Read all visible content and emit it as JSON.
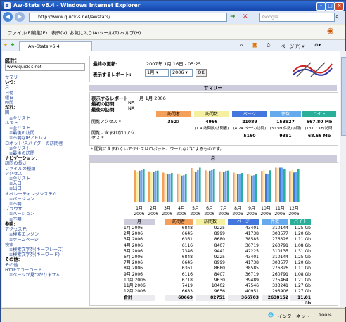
{
  "window": {
    "title": "Aw-Stats v6.4 - Windows Internet Explorer"
  },
  "address": {
    "url": "http://www.quick-s.net/awstats/",
    "search_placeholder": "Google"
  },
  "menu": [
    "ファイル(F)",
    "編集(E)",
    "表示(V)",
    "お気に入り(A)",
    "ツール(T)",
    "ヘルプ(H)"
  ],
  "tab": {
    "label": "Aw-Stats v6.4"
  },
  "toolbar": {
    "page_label": "ページ(P) ▾"
  },
  "status": {
    "zone": "インターネット",
    "zoom": "100%"
  },
  "sidebar": {
    "stats_label": "統計：",
    "site": "www.quick-s.net",
    "items": [
      {
        "text": "サマリー",
        "cls": "",
        "link": true
      },
      {
        "text": "いつ：",
        "cls": "h"
      },
      {
        "text": "月",
        "cls": "",
        "link": true
      },
      {
        "text": "日付",
        "cls": "",
        "link": true
      },
      {
        "text": "曜日",
        "cls": "",
        "link": true
      },
      {
        "text": "時間",
        "cls": "",
        "link": true
      },
      {
        "text": "だれ：",
        "cls": "h"
      },
      {
        "text": "国",
        "cls": "",
        "link": true
      },
      {
        "text": "≡全リスト",
        "cls": "s1",
        "link": true
      },
      {
        "text": "ホスト",
        "cls": "",
        "link": true
      },
      {
        "text": "≡全リスト",
        "cls": "s1",
        "link": true
      },
      {
        "text": "≡最後の訪問",
        "cls": "s1",
        "link": true
      },
      {
        "text": "≡不明なIPアドレス",
        "cls": "s1",
        "link": true
      },
      {
        "text": "ロボット/スパイダーの訪問者",
        "cls": "",
        "link": true
      },
      {
        "text": "≡全リスト",
        "cls": "s1",
        "link": true
      },
      {
        "text": "≡最後の訪問",
        "cls": "s1",
        "link": true
      },
      {
        "text": "ナビゲーション：",
        "cls": "h"
      },
      {
        "text": "訪問の長さ",
        "cls": "",
        "link": true
      },
      {
        "text": "ファイルの種類",
        "cls": "",
        "link": true
      },
      {
        "text": "アクセス",
        "cls": "",
        "link": true
      },
      {
        "text": "≡全リスト",
        "cls": "s1",
        "link": true
      },
      {
        "text": "≡入口",
        "cls": "s1",
        "link": true
      },
      {
        "text": "≡出口",
        "cls": "s1",
        "link": true
      },
      {
        "text": "オペレーティングシステム",
        "cls": "",
        "link": true
      },
      {
        "text": "≡バージョン",
        "cls": "s1",
        "link": true
      },
      {
        "text": "≡不明",
        "cls": "s1",
        "link": true
      },
      {
        "text": "ブラウザ",
        "cls": "",
        "link": true
      },
      {
        "text": "≡バージョン",
        "cls": "s1",
        "link": true
      },
      {
        "text": "≡不明",
        "cls": "s1",
        "link": true
      },
      {
        "text": "参照：",
        "cls": "h"
      },
      {
        "text": "アクセス元",
        "cls": "",
        "link": true
      },
      {
        "text": "≡検索エンジン",
        "cls": "s1",
        "link": true
      },
      {
        "text": "≡ホームページ",
        "cls": "s1",
        "link": true
      },
      {
        "text": "検索",
        "cls": "",
        "link": true
      },
      {
        "text": "≡検索文字列(キーフレーズ)",
        "cls": "s1",
        "link": true
      },
      {
        "text": "≡検索文字列(キーワード)",
        "cls": "s1",
        "link": true
      },
      {
        "text": "その他：",
        "cls": "h"
      },
      {
        "text": "その他",
        "cls": "",
        "link": true
      },
      {
        "text": "HTTPエラーコード",
        "cls": "",
        "link": true
      },
      {
        "text": "≡ページが見つかりません",
        "cls": "s1",
        "link": true
      }
    ]
  },
  "header": {
    "last_update_label": "最終の更新:",
    "last_update": "2007年 1月 16日 - 05:25",
    "report_label": "表示するレポート:",
    "month": "1月",
    "year": "2006",
    "ok": "OK"
  },
  "summary": {
    "title": "サマリー",
    "report_label": "表示するレポート",
    "report_value": "月 1月 2006",
    "first_visit_label": "最初の訪問",
    "first_visit": "NA",
    "last_visit_label": "最後の訪問",
    "last_visit": "NA",
    "cols": [
      "訪問者",
      "訪問数",
      "ページ",
      "件数",
      "バイト"
    ],
    "col_colors": [
      "#f4a05a",
      "#f4f0a0",
      "#4477dd",
      "#66aaee",
      "#2ab09a"
    ],
    "row1_label": "閲覧アクセス *",
    "row1": [
      "3527",
      "4966",
      "21089",
      "153927",
      "667.80 Mb"
    ],
    "row1_sub": [
      "",
      "(1.4 訪問数/訪問者)",
      "(4.24 ページ/訪問)",
      "(30.99 件数/訪問)",
      "(137.7 Kb/訪問)"
    ],
    "row2_label": "閲覧に含まれないアクセス *",
    "row2": [
      "",
      "",
      "5160",
      "9391",
      "68.66 Mb"
    ],
    "note": "* 閲覧に含まれないアクセスはロボット、ワームなどによるものです。"
  },
  "monthly": {
    "title": "月",
    "cols": [
      "月",
      "訪問者",
      "訪問数",
      "ページ",
      "件数",
      "バイト"
    ],
    "rows": [
      [
        "1月 2006",
        "6848",
        "9225",
        "43401",
        "310144",
        "1.25 Gb"
      ],
      [
        "2月 2006",
        "6645",
        "8999",
        "41738",
        "303577",
        "1.20 Gb"
      ],
      [
        "3月 2006",
        "6361",
        "8680",
        "38585",
        "276326",
        "1.11 Gb"
      ],
      [
        "4月 2006",
        "6116",
        "8407",
        "36719",
        "260791",
        "1.08 Gb"
      ],
      [
        "5月 2006",
        "7346",
        "9441",
        "42225",
        "310135",
        "1.31 Gb"
      ],
      [
        "6月 2006",
        "6848",
        "9225",
        "43401",
        "310144",
        "1.25 Gb"
      ],
      [
        "7月 2006",
        "6645",
        "8999",
        "41738",
        "303577",
        "1.20 Gb"
      ],
      [
        "8月 2006",
        "6361",
        "8680",
        "38585",
        "276326",
        "1.11 Gb"
      ],
      [
        "9月 2006",
        "6116",
        "8407",
        "36719",
        "260791",
        "1.08 Gb"
      ],
      [
        "10月 2006",
        "6718",
        "9630",
        "39489",
        "275464",
        "1.21 Gb"
      ],
      [
        "11月 2006",
        "7419",
        "10402",
        "47546",
        "333241",
        "1.27 Gb"
      ],
      [
        "12月 2006",
        "6683",
        "9656",
        "40951",
        "293906",
        "1.27 Gb"
      ]
    ],
    "total": [
      "合計",
      "60669",
      "82751",
      "366703",
      "2638152",
      "11.01 Gb"
    ],
    "chart_labels": [
      "1月",
      "2月",
      "3月",
      "4月",
      "5月",
      "6月",
      "7月",
      "8月",
      "9月",
      "10月",
      "11月",
      "12月"
    ],
    "chart_year": "2006"
  },
  "chart_data": {
    "type": "bar",
    "categories": [
      "1月 2006",
      "2月 2006",
      "3月 2006",
      "4月 2006",
      "5月 2006",
      "6月 2006",
      "7月 2006",
      "8月 2006",
      "9月 2006",
      "10月 2006",
      "11月 2006",
      "12月 2006"
    ],
    "series": [
      {
        "name": "訪問者",
        "values": [
          6848,
          6645,
          6361,
          6116,
          7346,
          6848,
          6645,
          6361,
          6116,
          6718,
          7419,
          6683
        ]
      },
      {
        "name": "訪問数",
        "values": [
          9225,
          8999,
          8680,
          8407,
          9441,
          9225,
          8999,
          8680,
          8407,
          9630,
          10402,
          9656
        ]
      },
      {
        "name": "ページ",
        "values": [
          43401,
          41738,
          38585,
          36719,
          42225,
          43401,
          41738,
          38585,
          36719,
          39489,
          47546,
          40951
        ]
      },
      {
        "name": "件数",
        "values": [
          310144,
          303577,
          276326,
          260791,
          310135,
          310144,
          303577,
          276326,
          260791,
          275464,
          333241,
          293906
        ]
      },
      {
        "name": "バイト",
        "values": [
          1.25,
          1.2,
          1.11,
          1.08,
          1.31,
          1.25,
          1.2,
          1.11,
          1.08,
          1.21,
          1.27,
          1.27
        ]
      }
    ]
  }
}
